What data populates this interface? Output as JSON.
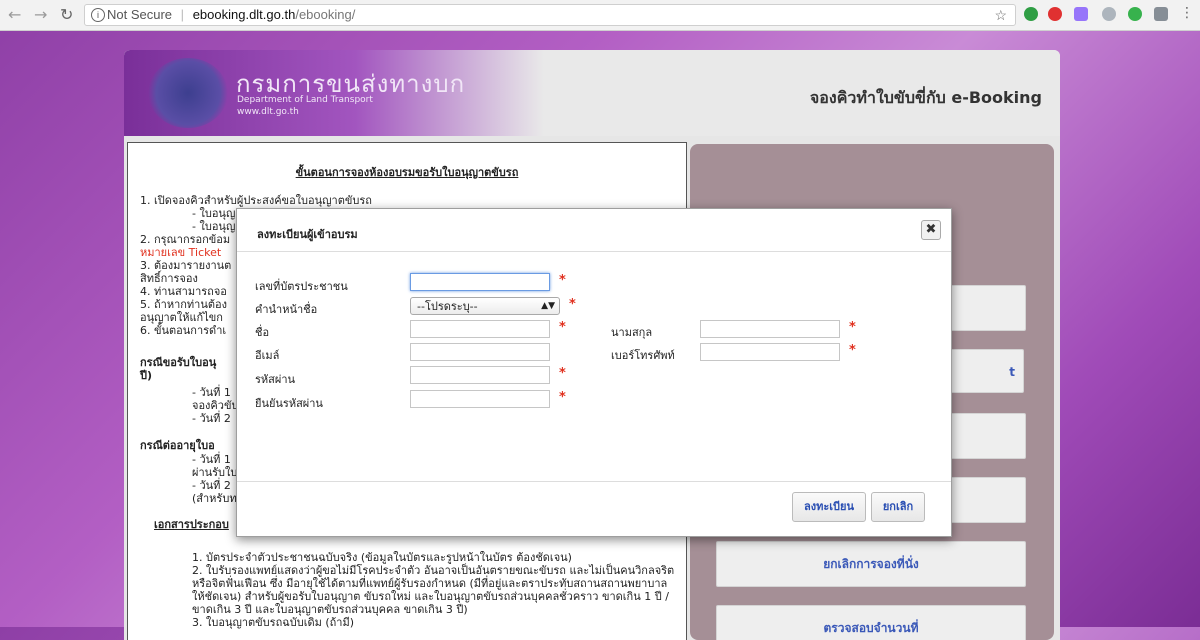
{
  "browser": {
    "security_label": "Not Secure",
    "url_host": "ebooking.dlt.go.th",
    "url_path": "/ebooking/"
  },
  "banner": {
    "org_name_th": "กรมการขนส่งทางบก",
    "org_name_en": "Department of Land Transport",
    "org_website": "www.dlt.go.th",
    "page_title": "จองคิวทำใบขับขี่กับ e-Booking"
  },
  "left_panel": {
    "heading": "ขั้นตอนการจองห้องอบรมขอรับใบอนุญาตขับรถ",
    "lines": [
      "1. เปิดจองคิวสำหรับผู้ประสงค์ขอใบอนุญาตขับรถ",
      "- ใบอนุญ",
      "- ใบอนุญ",
      "2. กรุณากรอกข้อม",
      "หมายเลข Ticket",
      "3. ต้องมารายงานต",
      "สิทธิ์การจอง",
      "4. ท่านสามารถจอ",
      "5. ถ้าหากท่านต้อง",
      "อนุญาตให้แก้ไขก",
      "6. ขั้นตอนการดำเ",
      "กรณีขอรับใบอนุ",
      "ปี)",
      "- วันที่ 1",
      "จองคิวขับ",
      "- วันที่ 2",
      "กรณีต่ออายุใบอ",
      "- วันที่ 1",
      "ผ่านรับใบ",
      "- วันที่ 2",
      "(สำหรับท",
      "เอกสารประกอบ",
      "1. บัตรประจำตัวประชาชนฉบับจริง (ข้อมูลในบัตรและรูปหน้าในบัตร ต้องชัดเจน)",
      "2. ใบรับรองแพทย์แสดงว่าผู้ขอไม่มีโรคประจำตัว อันอาจเป็นอันตรายขณะขับรถ และไม่เป็นคนวิกลจริต",
      "หรือจิตฟั่นเฟือน ซึ่ง มีอายุใช้ได้ตามที่แพทย์ผู้รับรองกำหนด (มีที่อยู่และตราประทับสถานสถานพยาบาล",
      "ให้ชัดเจน) สำหรับผู้ขอรับใบอนุญาต ขับรถใหม่ และใบอนุญาตขับรถส่วนบุคคลชั่วคราว ขาดเกิน 1 ปี /",
      "ขาดเกิน 3 ปี และใบอนุญาตขับรถส่วนบุคคล ขาดเกิน 3 ปี)",
      "3. ใบอนุญาตขับรถฉบับเดิม (ถ้ามี)"
    ]
  },
  "right_panel": {
    "buttons": [
      "",
      "t",
      "",
      "",
      "ยกเลิกการจองที่นั่ง",
      "ตรวจสอบจำนวนที่"
    ]
  },
  "modal": {
    "title": "ลงทะเบียนผู้เข้าอบรม",
    "labels": {
      "id_card": "เลขที่บัตรประชาชน",
      "prefix": "คำนำหน้าชื่อ",
      "first_name": "ชื่อ",
      "last_name": "นามสกุล",
      "email": "อีเมล์",
      "phone": "เบอร์โทรศัพท์",
      "password": "รหัสผ่าน",
      "confirm_password": "ยืนยันรหัสผ่าน"
    },
    "prefix_selected": "--โปรดระบุ--",
    "required_mark": "*",
    "submit_label": "ลงทะเบียน",
    "cancel_label": "ยกเลิก"
  }
}
